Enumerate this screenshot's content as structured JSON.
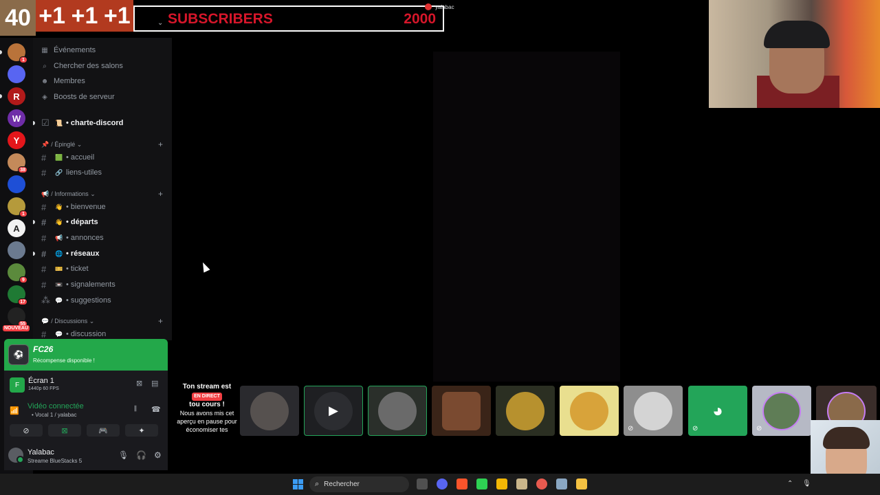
{
  "overlay": {
    "counter": "40",
    "plus": [
      "+1",
      "+1",
      "+1"
    ],
    "subs_label": "SUBSCRIBERS",
    "subs_count": "2000",
    "top_user": "yalabac"
  },
  "servers": [
    {
      "letter": "",
      "color": "#b9733a",
      "badge": "1"
    },
    {
      "letter": "",
      "color": "#5865f2",
      "badge": ""
    },
    {
      "letter": "R",
      "color": "#b11a1a",
      "badge": ""
    },
    {
      "letter": "W",
      "color": "#6f2da8",
      "badge": ""
    },
    {
      "letter": "Y",
      "color": "#e3161b",
      "badge": ""
    },
    {
      "letter": "",
      "color": "#c48a5a",
      "badge": "38"
    },
    {
      "letter": "",
      "color": "#1e4fd6",
      "badge": ""
    },
    {
      "letter": "",
      "color": "#b59a3b",
      "badge": "1"
    },
    {
      "letter": "A",
      "color": "#f2f2f2",
      "badge": ""
    },
    {
      "letter": "",
      "color": "#6b7a8f",
      "badge": ""
    },
    {
      "letter": "",
      "color": "#5b8a3c",
      "badge": "9"
    },
    {
      "letter": "",
      "color": "#1f7a34",
      "badge": "17"
    },
    {
      "letter": "",
      "color": "#222222",
      "badge": "55"
    }
  ],
  "nouveau": "NOUVEAU",
  "sidebar": {
    "nav": [
      {
        "icon": "▦",
        "label": "Événements"
      },
      {
        "icon": "⌕",
        "label": "Chercher des salons"
      },
      {
        "icon": "☻",
        "label": "Membres"
      },
      {
        "icon": "◈",
        "label": "Boosts de serveur"
      }
    ],
    "charte": "• charte-discord",
    "cat_pinned": "/ Épinglé",
    "pinned": [
      {
        "emoji": "🟩",
        "label": "• accueil",
        "bold": false
      },
      {
        "emoji": "🔗",
        "label": "liens-utiles",
        "bold": false
      }
    ],
    "cat_info": "/ Informations",
    "info": [
      {
        "emoji": "👋",
        "label": "• bienvenue",
        "bold": false
      },
      {
        "emoji": "👋",
        "label": "• départs",
        "bold": true
      },
      {
        "emoji": "📢",
        "label": "• annonces",
        "bold": false
      },
      {
        "emoji": "🌐",
        "label": "• réseaux",
        "bold": true
      },
      {
        "emoji": "🎫",
        "label": "• ticket",
        "bold": false
      },
      {
        "emoji": "📼",
        "label": "• signalements",
        "bold": false
      },
      {
        "emoji": "💬",
        "label": "• suggestions",
        "bold": false
      }
    ],
    "cat_disc": "/ Discussions",
    "disc": [
      {
        "emoji": "💬",
        "label": "• discussion",
        "bold": false
      }
    ]
  },
  "promo": {
    "title": "FC26",
    "subtitle": "Récompense disponible !"
  },
  "stream": {
    "name": "Écran 1",
    "quality": "1440p 60 FPS"
  },
  "voice": {
    "status": "Vidéo connectée",
    "channel": "• Vocal 1 / yalabac"
  },
  "user": {
    "name": "Yalabac",
    "status": "Streame BlueStacks 5"
  },
  "tiles": {
    "text_hdr": "Ton stream est",
    "text_live": "EN DIRECT",
    "text_cours": "tou cours !",
    "text_body": "Nous avons mis cet aperçu en pause pour économiser tes"
  },
  "tile_colors": [
    "#2a2a2e",
    "#1e1f22",
    "#2a2f2a",
    "#3a2418",
    "#2b2f22",
    "#e9df8f",
    "#8e8e8e",
    "#23a559",
    "#b6b9c5",
    "#3a2d2a"
  ],
  "taskbar": {
    "search": "Rechercher"
  }
}
